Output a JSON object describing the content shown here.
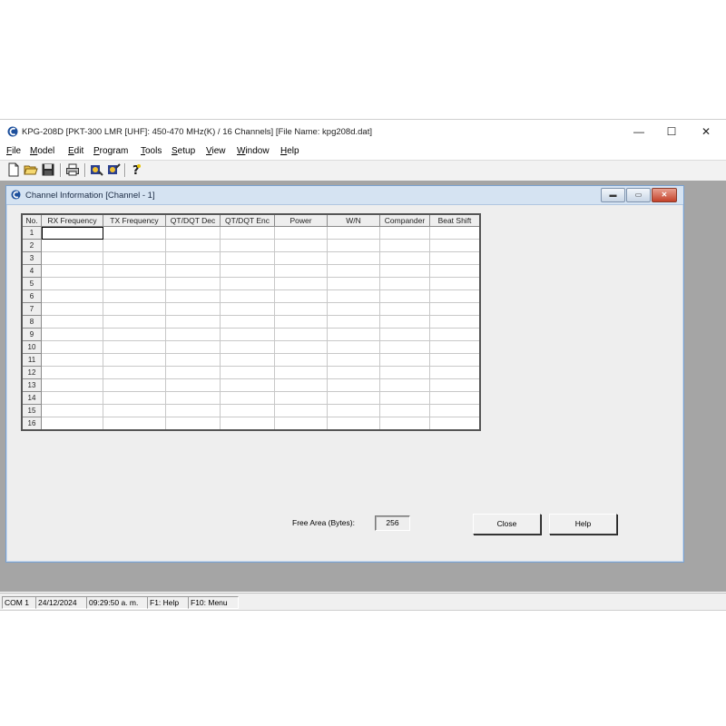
{
  "window": {
    "title": "KPG-208D [PKT-300  LMR  [UHF]: 450-470 MHz(K) / 16 Channels] [File Name: kpg208d.dat]",
    "minimize": "—",
    "maximize": "☐",
    "close": "✕"
  },
  "menu": [
    "File",
    "Model",
    "Edit",
    "Program",
    "Tools",
    "Setup",
    "View",
    "Window",
    "Help"
  ],
  "toolbar": [
    "new-file",
    "open-folder",
    "save-disk",
    "print",
    "read-radio",
    "write-radio",
    "help"
  ],
  "child_window": {
    "title": "Channel Information [Channel - 1]"
  },
  "grid": {
    "columns": [
      "No.",
      "RX Frequency",
      "TX Frequency",
      "QT/DQT Dec",
      "QT/DQT Enc",
      "Power",
      "W/N",
      "Compander",
      "Beat Shift"
    ],
    "rows": [
      "1",
      "2",
      "3",
      "4",
      "5",
      "6",
      "7",
      "8",
      "9",
      "10",
      "11",
      "12",
      "13",
      "14",
      "15",
      "16"
    ],
    "selected_row": 1
  },
  "free_area": {
    "label": "Free Area (Bytes):",
    "value": "256"
  },
  "buttons": {
    "close": "Close",
    "help": "Help"
  },
  "status": {
    "port": "COM 1",
    "date": "24/12/2024",
    "time": "09:29:50 a. m.",
    "f1": "F1: Help",
    "f10": "F10: Menu"
  }
}
